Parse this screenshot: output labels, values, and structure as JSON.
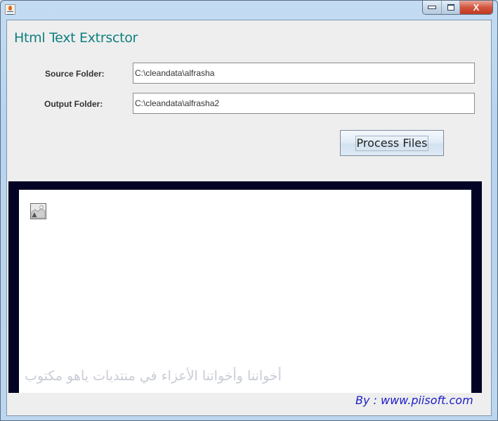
{
  "window": {
    "app_icon": "java-icon",
    "controls": {
      "minimize": "minimize",
      "maximize": "maximize",
      "close": "X"
    }
  },
  "header": {
    "title": "Html Text Extrsctor"
  },
  "form": {
    "source": {
      "label": "Source Folder:",
      "value": "C:\\cleandata\\alfrasha"
    },
    "output": {
      "label": "Output Folder:",
      "value": "C:\\cleandata\\alfrasha2"
    },
    "process_button": "Process Files"
  },
  "preview": {
    "broken_image_icon": "broken-image-icon",
    "arabic_caption": "أخواننا وأخواتنا الأعزاء في منتديات ياهو مكتوب"
  },
  "footer": {
    "credit": "By : www.piisoft.com"
  },
  "colors": {
    "title": "#0f7f7f",
    "credit": "#1c1cc8",
    "preview_border": "#030326",
    "client_bg": "#eeeeee"
  }
}
